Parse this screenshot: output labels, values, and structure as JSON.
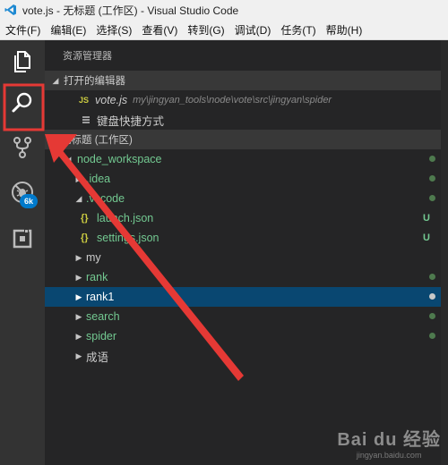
{
  "window": {
    "title": "vote.js - 无标题 (工作区) - Visual Studio Code"
  },
  "menu": [
    "文件(F)",
    "编辑(E)",
    "选择(S)",
    "查看(V)",
    "转到(G)",
    "调试(D)",
    "任务(T)",
    "帮助(H)"
  ],
  "activity": {
    "scm_badge": "6k"
  },
  "explorer": {
    "header": "资源管理器",
    "open_editors": {
      "label": "打开的编辑器",
      "items": [
        {
          "icon": "JS",
          "name": "vote.js",
          "path": "my\\jingyan_tools\\node\\vote\\src\\jingyan\\spider"
        },
        {
          "name": "键盘快捷方式"
        }
      ]
    },
    "workspace": {
      "label": "无标题 (工作区)",
      "tree": [
        {
          "name": "node_workspace"
        },
        {
          "name": ".idea"
        },
        {
          "name": ".vscode"
        },
        {
          "name": "launch.json",
          "badge": "U"
        },
        {
          "name": "settings.json",
          "badge": "U"
        },
        {
          "name": "my"
        },
        {
          "name": "rank"
        },
        {
          "name": "rank1"
        },
        {
          "name": "search"
        },
        {
          "name": "spider"
        },
        {
          "name": "成语"
        }
      ]
    }
  },
  "watermark": {
    "brand": "Bai du 经验",
    "url": "jingyan.baidu.com"
  },
  "colors": {
    "highlight_box": "#e53935",
    "accent": "#007acc",
    "selection": "#094771",
    "git_green": "#73c991"
  }
}
